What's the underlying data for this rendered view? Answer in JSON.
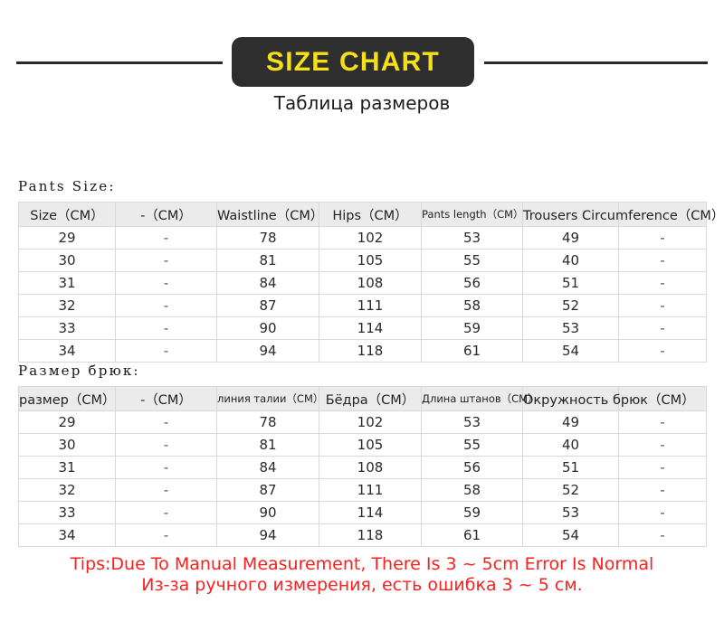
{
  "header": {
    "title": "SIZE CHART",
    "subtitle": "Таблица размеров",
    "banner_bg": "#2e2e2e",
    "title_color": "#f5e017",
    "rule_color": "#2b2b2b"
  },
  "tables": [
    {
      "label": "Pants Size:",
      "columns": [
        {
          "label": "Size（CM）",
          "small": false
        },
        {
          "label": "-（CM）",
          "small": false
        },
        {
          "label": "Waistline（CM）",
          "small": false
        },
        {
          "label": "Hips（CM）",
          "small": false
        },
        {
          "label": "Pants length（CM）",
          "small": true
        },
        {
          "label": "Trousers Circumference（CM）",
          "small": false
        },
        {
          "label": "",
          "small": false
        }
      ],
      "rows": [
        [
          "29",
          "-",
          "78",
          "102",
          "53",
          "49",
          "-"
        ],
        [
          "30",
          "-",
          "81",
          "105",
          "55",
          "40",
          "-"
        ],
        [
          "31",
          "-",
          "84",
          "108",
          "56",
          "51",
          "-"
        ],
        [
          "32",
          "-",
          "87",
          "111",
          "58",
          "52",
          "-"
        ],
        [
          "33",
          "-",
          "90",
          "114",
          "59",
          "53",
          "-"
        ],
        [
          "34",
          "-",
          "94",
          "118",
          "61",
          "54",
          "-"
        ]
      ]
    },
    {
      "label": "Размер брюк:",
      "columns": [
        {
          "label": "размер（CM）",
          "small": false
        },
        {
          "label": "-（CM）",
          "small": false
        },
        {
          "label": "линия талии（CM）",
          "small": true
        },
        {
          "label": "Бёдра（CM）",
          "small": false
        },
        {
          "label": "Длина штанов（CM）",
          "small": true
        },
        {
          "label": "Окружность брюк（CM）",
          "small": false
        },
        {
          "label": "",
          "small": false
        }
      ],
      "rows": [
        [
          "29",
          "-",
          "78",
          "102",
          "53",
          "49",
          "-"
        ],
        [
          "30",
          "-",
          "81",
          "105",
          "55",
          "40",
          "-"
        ],
        [
          "31",
          "-",
          "84",
          "108",
          "56",
          "51",
          "-"
        ],
        [
          "32",
          "-",
          "87",
          "111",
          "58",
          "52",
          "-"
        ],
        [
          "33",
          "-",
          "90",
          "114",
          "59",
          "53",
          "-"
        ],
        [
          "34",
          "-",
          "94",
          "118",
          "61",
          "54",
          "-"
        ]
      ]
    }
  ],
  "tips": {
    "english": "Tips:Due To Manual Measurement, There Is 3 ~ 5cm Error Is Normal",
    "russian": "Из-за ручного измерения, есть ошибка 3 ~ 5 см.",
    "color": "#fa2020"
  }
}
